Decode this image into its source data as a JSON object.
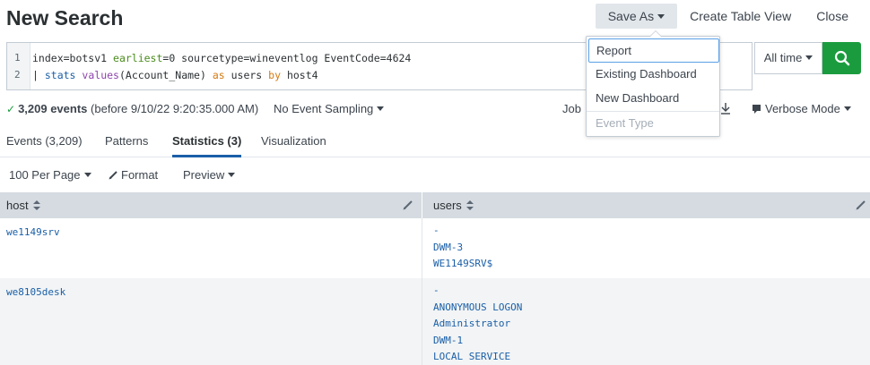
{
  "header": {
    "title": "New Search",
    "save_as_label": "Save As",
    "create_table_view_label": "Create Table View",
    "close_label": "Close"
  },
  "search": {
    "line_numbers": [
      "1",
      "2"
    ],
    "line1": {
      "prefix": "index=botsv1 ",
      "earliest": "earliest",
      "rest": "=0 sourcetype=wineventlog EventCode=4624"
    },
    "line2": {
      "pipe": "| ",
      "stats": "stats",
      "sp1": " ",
      "values": "values",
      "arg": "(Account_Name) ",
      "as": "as",
      "mid": " users ",
      "by": "by",
      "end": " host4"
    },
    "time_range_label": "All time"
  },
  "status": {
    "events_count": "3,209 events",
    "events_detail": "(before 9/10/22 9:20:35.000 AM)",
    "sampling_label": "No Event Sampling",
    "job_label": "Job",
    "mode_label": "Verbose Mode"
  },
  "tabs": [
    {
      "label": "Events (3,209)"
    },
    {
      "label": "Patterns"
    },
    {
      "label": "Statistics (3)"
    },
    {
      "label": "Visualization"
    }
  ],
  "table_controls": {
    "per_page": "100 Per Page",
    "format": "Format",
    "preview": "Preview"
  },
  "table": {
    "columns": [
      "host",
      "users"
    ],
    "rows": [
      {
        "host": "we1149srv",
        "users": [
          "-",
          "DWM-3",
          "WE1149SRV$"
        ]
      },
      {
        "host": "we8105desk",
        "users": [
          "-",
          "ANONYMOUS LOGON",
          "Administrator",
          "DWM-1",
          "LOCAL SERVICE"
        ]
      }
    ]
  },
  "save_as_menu": {
    "items": [
      "Report",
      "Existing Dashboard",
      "New Dashboard",
      "Event Type"
    ]
  },
  "icons": {
    "search": "search-icon",
    "download": "download-icon",
    "mode": "mode-icon",
    "pencil": "pencil-icon",
    "sort": "sort-icon"
  },
  "colors": {
    "accent_blue": "#1a5fa8",
    "search_green": "#1a9c3e"
  }
}
